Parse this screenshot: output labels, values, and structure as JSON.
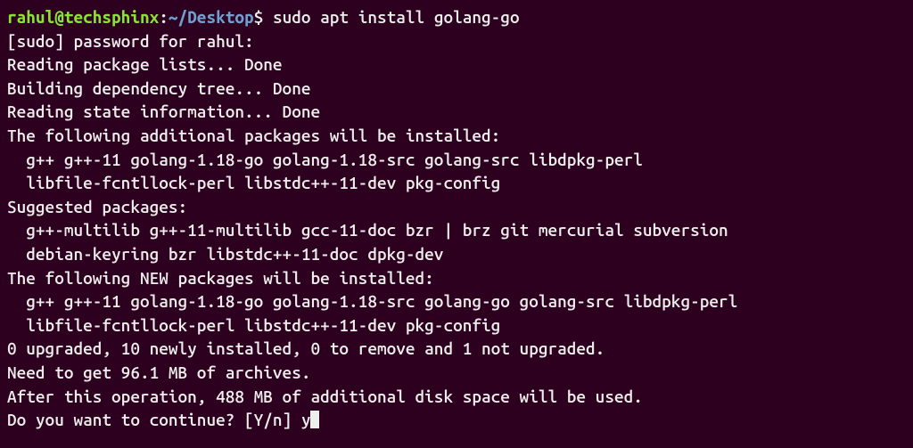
{
  "prompt": {
    "user": "rahul",
    "at": "@",
    "host": "techsphinx",
    "colon": ":",
    "path": "~/Desktop",
    "dollar": "$ "
  },
  "command": "sudo apt install golang-go",
  "output": {
    "line1": "[sudo] password for rahul:",
    "line2": "Reading package lists... Done",
    "line3": "Building dependency tree... Done",
    "line4": "Reading state information... Done",
    "line5": "The following additional packages will be installed:",
    "line6": "  g++ g++-11 golang-1.18-go golang-1.18-src golang-src libdpkg-perl",
    "line7": "  libfile-fcntllock-perl libstdc++-11-dev pkg-config",
    "line8": "Suggested packages:",
    "line9": "  g++-multilib g++-11-multilib gcc-11-doc bzr | brz git mercurial subversion",
    "line10": "  debian-keyring bzr libstdc++-11-doc dpkg-dev",
    "line11": "The following NEW packages will be installed:",
    "line12": "  g++ g++-11 golang-1.18-go golang-1.18-src golang-go golang-src libdpkg-perl",
    "line13": "  libfile-fcntllock-perl libstdc++-11-dev pkg-config",
    "line14": "0 upgraded, 10 newly installed, 0 to remove and 1 not upgraded.",
    "line15": "Need to get 96.1 MB of archives.",
    "line16": "After this operation, 488 MB of additional disk space will be used.",
    "line17": "Do you want to continue? [Y/n] ",
    "input": "y"
  }
}
